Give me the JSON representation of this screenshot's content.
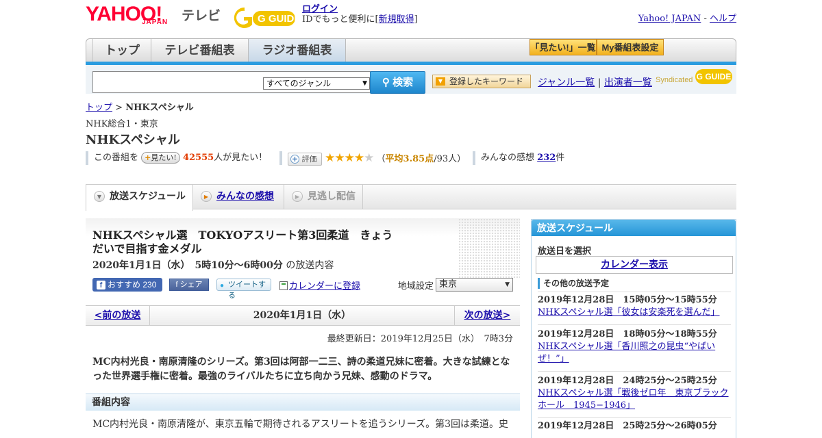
{
  "header": {
    "logo_yahoo": "YAHOO!",
    "logo_japan": "JAPAN",
    "logo_tv": "テレビ",
    "logo_gguide": "G GUIDE",
    "login_label": "ログイン",
    "login_desc_prefix": "IDでもっと便利に[",
    "signup_label": "新規取得",
    "login_desc_suffix": "]",
    "yahoo_japan_link": "Yahoo! JAPAN",
    "separator": " - ",
    "help_link": "ヘルプ"
  },
  "nav": {
    "tabs": [
      "トップ",
      "テレビ番組表",
      "ラジオ番組表"
    ],
    "mitai_list": "「見たい!」一覧",
    "my_schedule": "My番組表設定"
  },
  "search": {
    "input_value": "",
    "genre_selected": "すべてのジャンル",
    "search_button": "検索",
    "keyword_button": "登録したキーワード",
    "genre_list_link": "ジャンル一覧",
    "divider": "|",
    "performer_list_link": "出演者一覧",
    "syndicated": "Syndicated",
    "syndicated_logo": "G GUIDE"
  },
  "breadcrumb": {
    "top": "トップ",
    "sep": ">",
    "current": "NHKスペシャル"
  },
  "program": {
    "channel": "NHK総合1・東京",
    "title": "NHKスペシャル",
    "mitai_prefix": "この番組を",
    "mitai_button": "見たい!",
    "mitai_count": "42555",
    "mitai_suffix": "人が見たい！",
    "rating_button": "評価",
    "rating_avg_open": "（",
    "rating_avg": "平均3.85点",
    "rating_people": "/93人）",
    "stars": 3.85,
    "impressions_label": "みんなの感想",
    "impressions_count": "232",
    "impressions_suffix": "件"
  },
  "tabs": {
    "schedule": "放送スケジュール",
    "impressions": "みんなの感想",
    "missed": "見逃し配信"
  },
  "episode": {
    "title": "NHKスペシャル選　TOKYOアスリート第3回柔道　きょうだいで目指す金メダル",
    "date": "2020年1月1日（水）　5時10分～6時00分",
    "date_suffix": "の放送内容",
    "fb_recommend": "おすすめ",
    "fb_count": "230",
    "fb_share": "シェア",
    "tweet": "ツイートする",
    "calendar_register": "カレンダーに登録",
    "region_label": "地域設定",
    "region_value": "東京"
  },
  "pager": {
    "prev": "<前の放送",
    "current": "2020年1月1日（水）",
    "next": "次の放送>"
  },
  "updated": "最終更新日：2019年12月25日（水）　7時3分",
  "summary": "MC内村光良・南原清隆のシリーズ。第3回は阿部一二三、詩の柔道兄妹に密着。大きな試練となった世界選手権に密着。最強のライバルたちに立ち向かう兄妹、感動のドラマ。",
  "section_title": "番組内容",
  "detail": "MC内村光良・南原清隆が、東京五輪で期待されるアスリートを追うシリーズ。第3回は柔道。史",
  "sidebar": {
    "title": "放送スケジュール",
    "select_date": "放送日を選択",
    "calendar_button": "カレンダー表示",
    "other_schedule": "その他の放送予定",
    "items": [
      {
        "date": "2019年12月28日　15時05分～15時55分",
        "title": "NHKスペシャル選「彼女は安楽死を選んだ」"
      },
      {
        "date": "2019年12月28日　18時05分～18時55分",
        "title": "NHKスペシャル選「香川照之の昆虫“やばいぜ！”」"
      },
      {
        "date": "2019年12月28日　24時25分～25時25分",
        "title": "NHKスペシャル選「戦後ゼロ年　東京ブラックホール　1945−1946」"
      },
      {
        "date": "2019年12月28日　25時25分～26時05分",
        "title": ""
      }
    ]
  },
  "colors": {
    "accent_blue": "#2a9ce0",
    "yahoo_red": "#ff0033",
    "link": "#1a0dab",
    "star": "#f0a400"
  }
}
